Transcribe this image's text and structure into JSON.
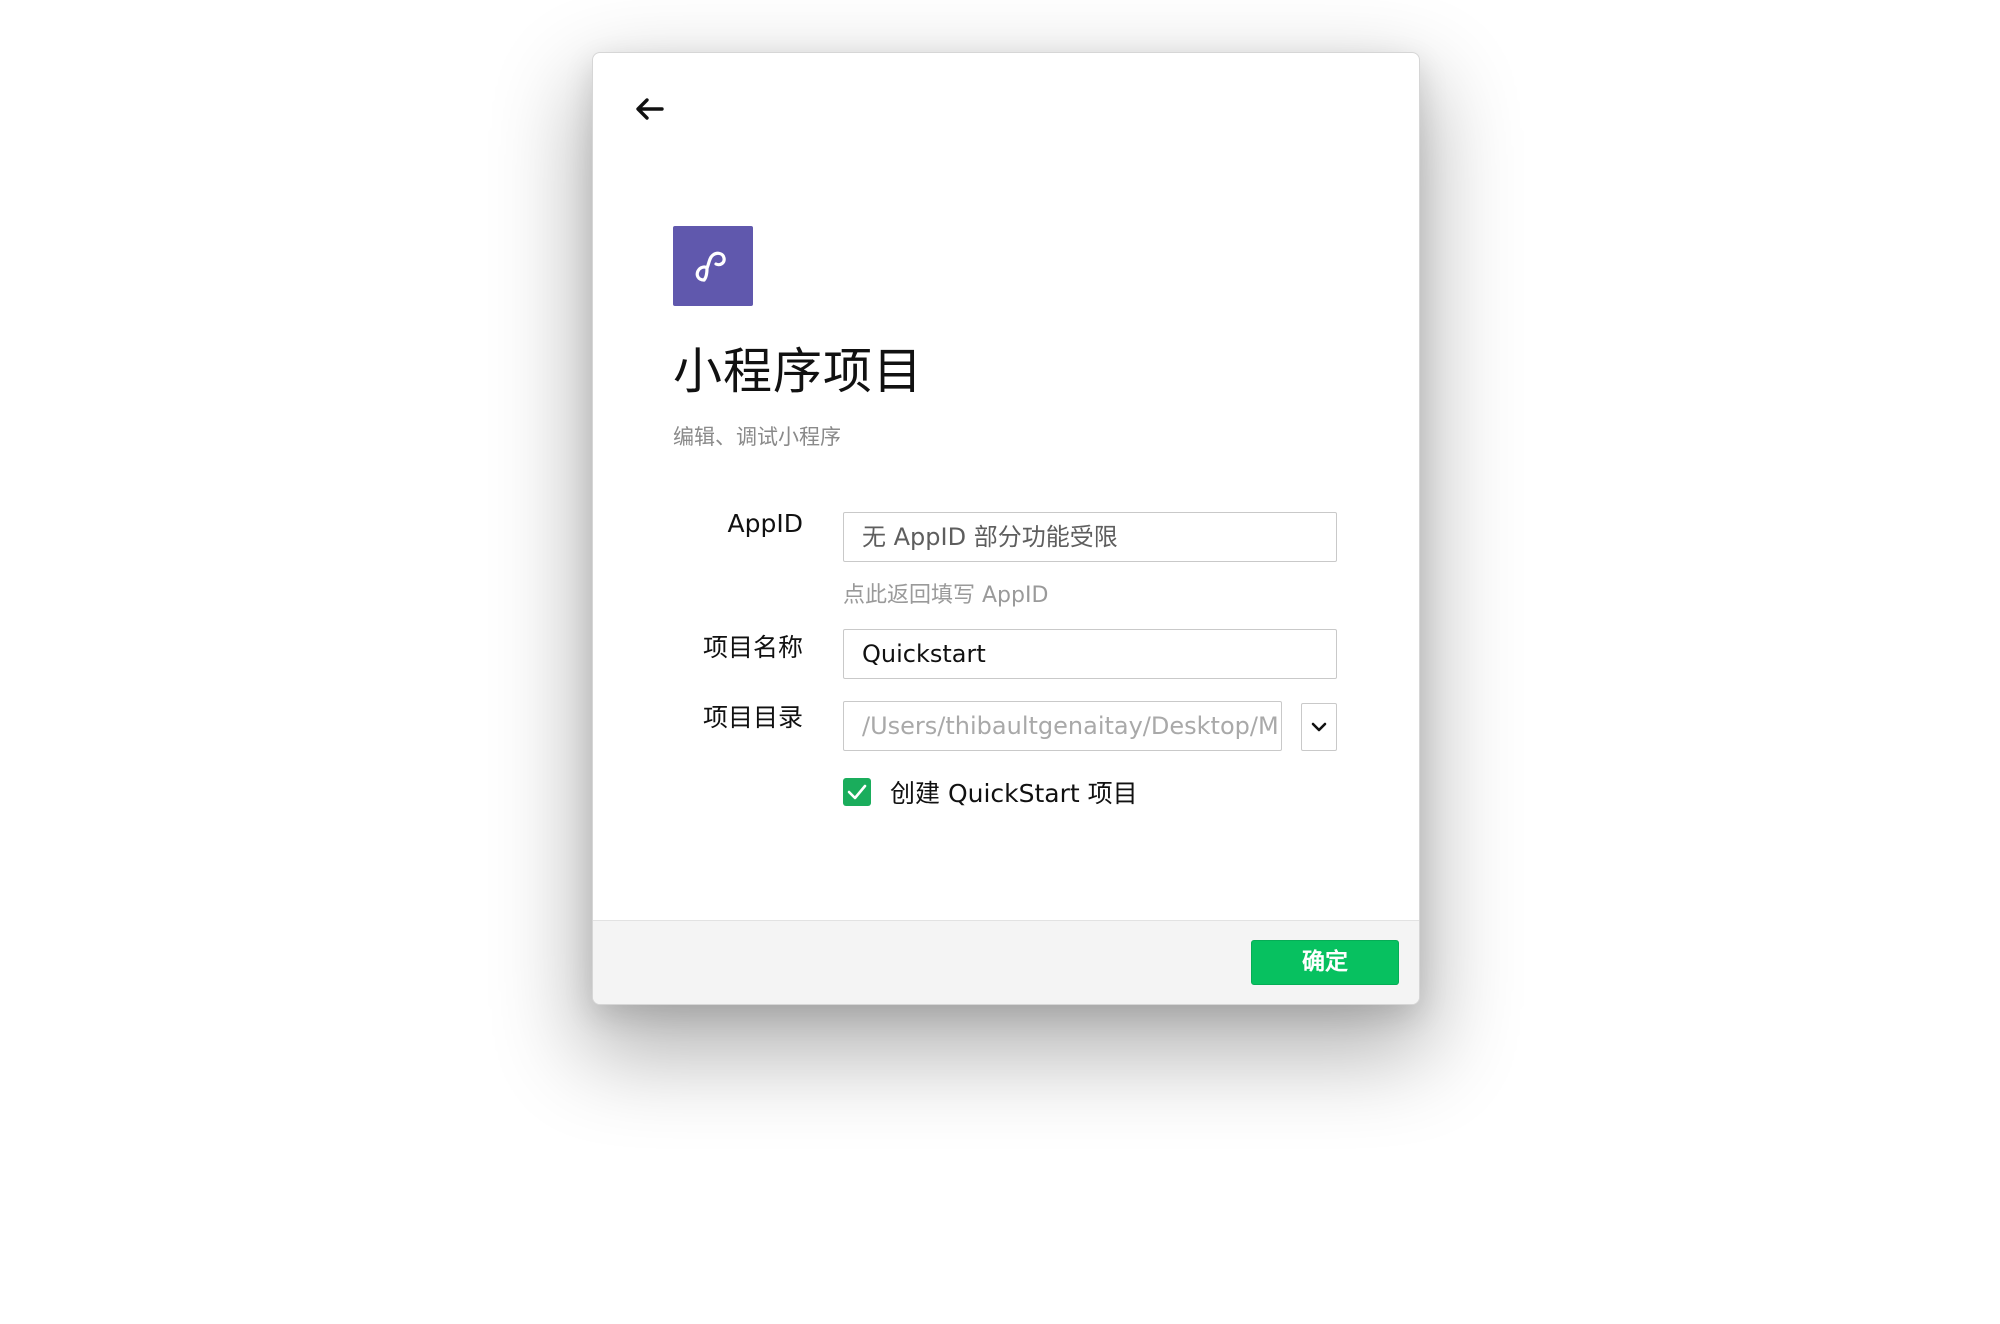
{
  "dialog": {
    "title": "小程序项目",
    "subtitle": "编辑、调试小程序"
  },
  "icons": {
    "back": "arrow-left-icon",
    "logo": "mini-program-logo-icon",
    "dropdown": "chevron-down-icon",
    "checkbox": "check-icon"
  },
  "form": {
    "appid_label": "AppID",
    "appid_value": "无 AppID 部分功能受限",
    "appid_hint": "点此返回填写 AppID",
    "name_label": "项目名称",
    "name_value": "Quickstart",
    "dir_label": "项目目录",
    "dir_value": "/Users/thibaultgenaitay/Desktop/M",
    "quickstart_label": "创建 QuickStart 项目",
    "quickstart_checked": true
  },
  "footer": {
    "confirm_label": "确定"
  },
  "colors": {
    "accent": "#07c160",
    "logo_bg": "#6058ad",
    "footer_bg": "#f4f4f4"
  }
}
